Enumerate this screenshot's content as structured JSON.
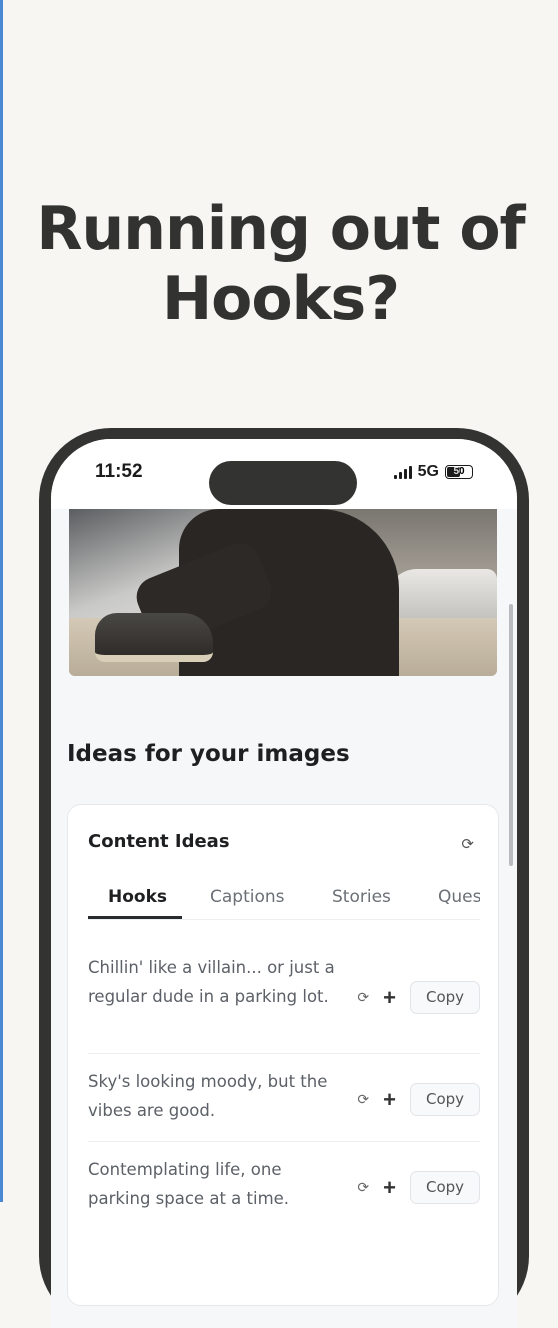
{
  "promo": {
    "headline_line1": "Running out of",
    "headline_line2": "Hooks?"
  },
  "status_bar": {
    "time": "11:52",
    "network": "5G",
    "battery": "50"
  },
  "section": {
    "title": "Ideas for your images"
  },
  "card": {
    "title": "Content Ideas",
    "tabs": [
      {
        "label": "Hooks",
        "active": true
      },
      {
        "label": "Captions",
        "active": false
      },
      {
        "label": "Stories",
        "active": false
      },
      {
        "label": "Ques",
        "active": false
      }
    ],
    "ideas": [
      {
        "text": "Chillin' like a villain... or just a regular dude in a parking lot.",
        "copy_label": "Copy"
      },
      {
        "text": "Sky's looking moody, but the vibes are good.",
        "copy_label": "Copy"
      },
      {
        "text": "Contemplating life, one parking space at a time.",
        "copy_label": "Copy"
      }
    ]
  },
  "icons": {
    "refresh": "refresh-icon",
    "plus": "plus-icon"
  }
}
